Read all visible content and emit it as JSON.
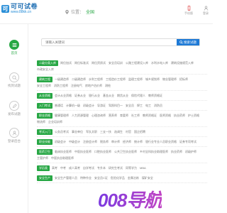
{
  "header": {
    "logo_title": "可可试卷",
    "logo_sub": "www.88kk.cn",
    "logo_mark": "可",
    "location_label": "位置：",
    "location_city": "全国",
    "actions": [
      {
        "label": "手机版",
        "icon": "phone-icon"
      },
      {
        "label": "登录",
        "icon": "user-icon"
      }
    ]
  },
  "sidebar": {
    "items": [
      {
        "label": "首页",
        "icon": "list-icon",
        "active": true
      },
      {
        "label": "找到试题",
        "icon": "search-icon",
        "active": false
      },
      {
        "label": "发布试题",
        "icon": "edit-icon",
        "active": false
      },
      {
        "label": "登录后台",
        "icon": "login-icon",
        "active": false
      }
    ]
  },
  "search": {
    "placeholder": "请输入关键词",
    "button_label": "搜索试题"
  },
  "categories": [
    {
      "label": "二级分类入库",
      "links": [
        "岗位加试",
        "岗位标准试",
        "岗位资质试",
        "安全员培训",
        "公路工程建设入库",
        "水利水电入库",
        "建筑设施规范入库",
        "市政安全入库"
      ]
    },
    {
      "label": "建筑工程",
      "links": [
        "一级建造师",
        "二级建造师",
        "水利工程师",
        "工程造价工程师",
        "监理工程师",
        "城乡规划师",
        "物业管理师",
        "招标师",
        "安全工程师",
        "消防工程师",
        "注册电气",
        "房地产估价师",
        "测绘"
      ]
    },
    {
      "label": "从业资格",
      "links": [
        "会计从业资格",
        "证券从业",
        "银行从业",
        "基金从业",
        "期货从业",
        "保险代理人",
        "教师资格证"
      ]
    },
    {
      "label": "入门考试",
      "links": [
        "普通话",
        "计算机一级",
        "初级会计",
        "导游证",
        "驾照科目一",
        "安全员",
        "焊工",
        "电工",
        "消防员"
      ]
    },
    {
      "label": "职业资格",
      "links": [
        "健康管理师",
        "人力资源管理",
        "心理咨询师",
        "营养师",
        "育婴师",
        "社工师",
        "教师资格证",
        "医师资格",
        "执业药师",
        "护士资格",
        "物流师",
        "企业培训师"
      ]
    },
    {
      "label": "考试入门",
      "links": [
        "公务员考试",
        "事业单位",
        "军队文职",
        "三支一扶",
        "选调生",
        "村官",
        "国企招聘"
      ]
    },
    {
      "label": "职业技能",
      "links": [
        "初级会计",
        "中级会计",
        "注册会计师",
        "税务师",
        "审计师",
        "经济师",
        "统计师",
        "银行业专业人员职业资格",
        "证券专项考试"
      ]
    },
    {
      "label": "医药卫生",
      "links": [
        "临床执业医师",
        "中医执业医师",
        "口腔执业医师",
        "公共卫生执业医师",
        "乡村全科执业助理医师",
        "执业药师",
        "初级护师",
        "主管护师",
        "中医执业助理医师"
      ]
    },
    {
      "label": "学历类",
      "links": [
        "高考",
        "中考",
        "成人高考",
        "自学考试",
        "专升本",
        "研究生考试",
        "同等学力",
        "MBA"
      ]
    },
    {
      "label": "安全生产",
      "links": [
        "安全生产管理人员",
        "特种作业",
        "安全员C证",
        "危险化学品",
        "金属冶炼",
        "煤矿安全"
      ]
    }
  ],
  "watermark": "008导航",
  "colors": {
    "accent": "#28a745",
    "search_button": "#1e7ad6",
    "logo": "#1f6fb4",
    "watermark": "#8a3ad6"
  }
}
